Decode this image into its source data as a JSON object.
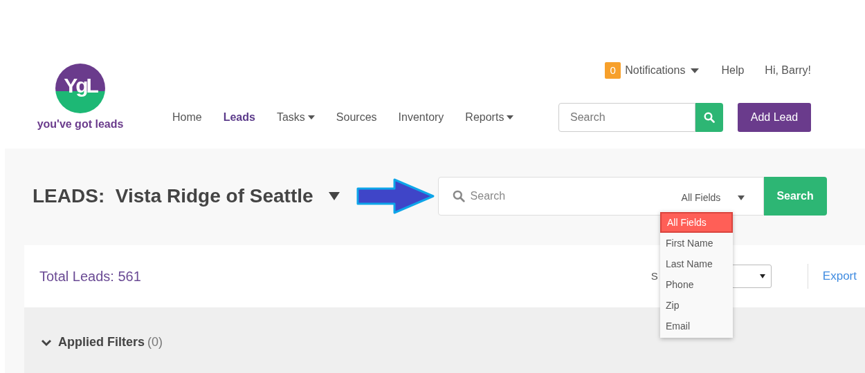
{
  "logo": {
    "monogram": "YgL",
    "tagline": "you've got leads"
  },
  "top_links": {
    "notification_count": "0",
    "notifications": "Notifications",
    "help": "Help",
    "greeting": "Hi, Barry!"
  },
  "nav": [
    {
      "label": "Home",
      "selected": false,
      "dropdown": false
    },
    {
      "label": "Leads",
      "selected": true,
      "dropdown": false
    },
    {
      "label": "Tasks",
      "selected": false,
      "dropdown": true
    },
    {
      "label": "Sources",
      "selected": false,
      "dropdown": false
    },
    {
      "label": "Inventory",
      "selected": false,
      "dropdown": false
    },
    {
      "label": "Reports",
      "selected": false,
      "dropdown": true
    }
  ],
  "header_search": {
    "placeholder": "Search"
  },
  "add_lead_button": "Add Lead",
  "page_title": "LEADS:  Vista Ridge of Seattle",
  "lead_search": {
    "placeholder": "Search",
    "field": "All Fields",
    "button": "Search",
    "options": [
      {
        "label": "All Fields",
        "selected": true
      },
      {
        "label": "First Name",
        "selected": false
      },
      {
        "label": "Last Name",
        "selected": false
      },
      {
        "label": "Phone",
        "selected": false
      },
      {
        "label": "Zip",
        "selected": false
      },
      {
        "label": "Email",
        "selected": false
      }
    ]
  },
  "total_leads": "Total Leads: 561",
  "sort_label": "S",
  "export_link": "Export",
  "filters": {
    "label": "Applied Filters",
    "count": "(0)",
    "expanded": true
  }
}
